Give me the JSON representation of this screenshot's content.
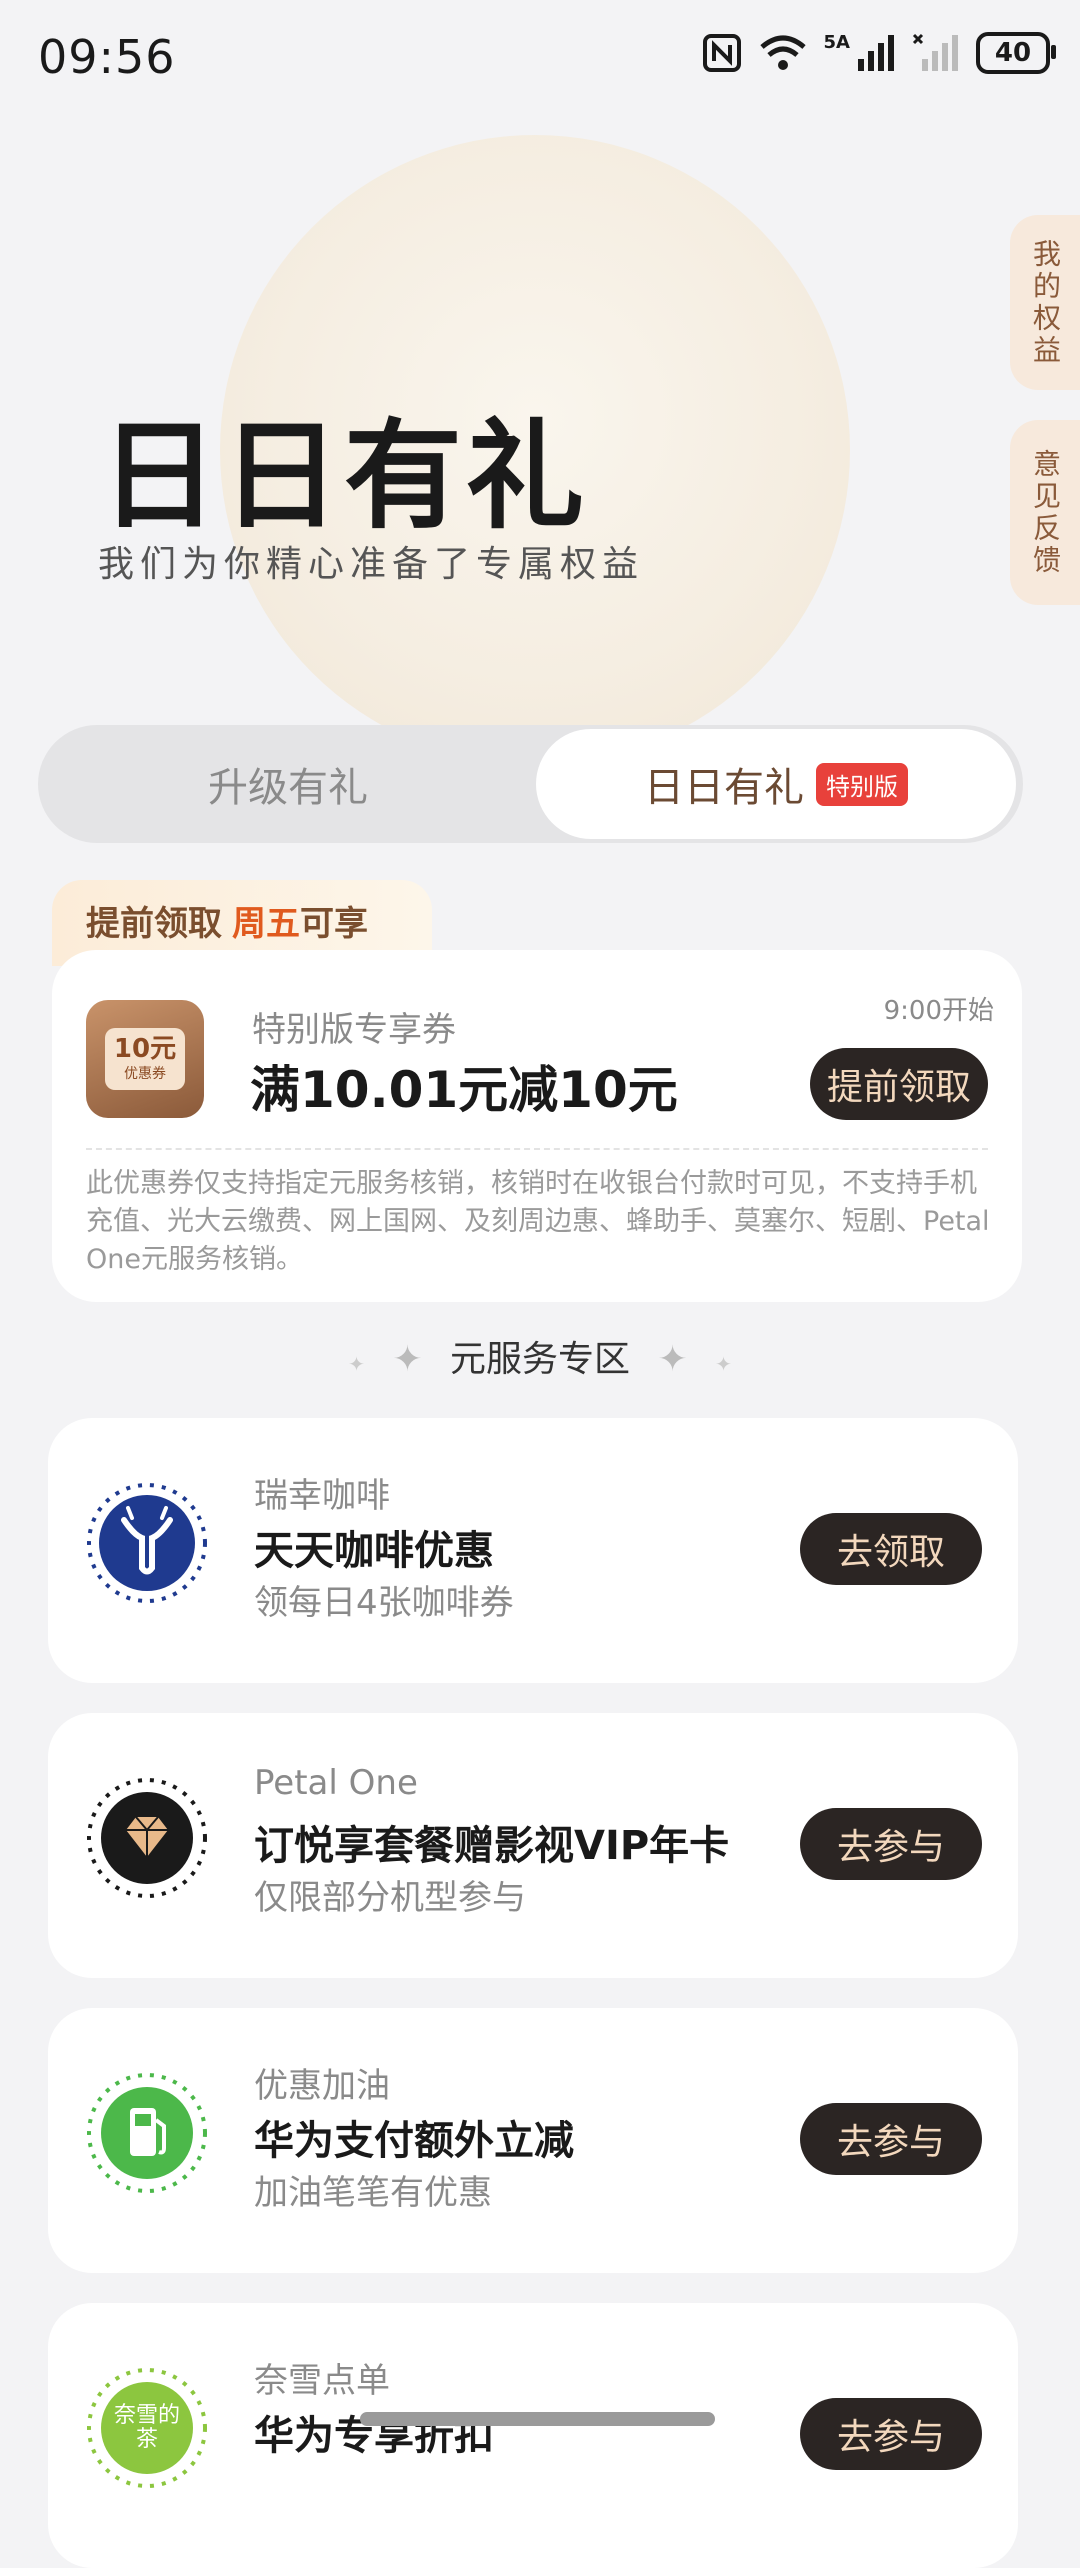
{
  "status_bar": {
    "time": "09:56",
    "network": "5A",
    "battery": "40"
  },
  "hero": {
    "title": "日日有礼",
    "subtitle": "我们为你精心准备了专属权益"
  },
  "side_tabs": {
    "my_benefits": "我的权益",
    "feedback": "意见反馈"
  },
  "tabs": {
    "upgrade": "升级有礼",
    "daily": "日日有礼",
    "daily_badge": "特别版"
  },
  "early_tag": {
    "prefix": "提前领取",
    "day": "周五",
    "suffix": "可享"
  },
  "coupon": {
    "icon_value": "10元",
    "icon_caption": "优惠券",
    "subtitle": "特别版专享券",
    "title": "满10.01元减10元",
    "start_time": "9:00开始",
    "button": "提前领取",
    "description": "此优惠券仅支持指定元服务核销，核销时在收银台付款时可见，不支持手机充值、光大云缴费、网上国网、及刻周边惠、蜂助手、莫塞尔、短剧、Petal One元服务核销。"
  },
  "section": {
    "title": "元服务专区"
  },
  "services": [
    {
      "brand": "瑞幸咖啡",
      "title": "天天咖啡优惠",
      "desc": "领每日4张咖啡券",
      "button": "去领取",
      "icon": "luckin-deer-icon"
    },
    {
      "brand": "Petal One",
      "title": "订悦享套餐赠影视VIP年卡",
      "desc": "仅限部分机型参与",
      "button": "去参与",
      "icon": "diamond-icon"
    },
    {
      "brand": "优惠加油",
      "title": "华为支付额外立减",
      "desc": "加油笔笔有优惠",
      "button": "去参与",
      "icon": "fuel-pump-icon"
    },
    {
      "brand": "奈雪点单",
      "title": "华为专享折扣",
      "desc": "",
      "button": "去参与",
      "icon": "nayuki-icon",
      "icon_text": "奈雪的茶"
    }
  ],
  "colors": {
    "accent_dark": "#2b2523",
    "accent_text": "#f3d8bd",
    "highlight": "#e05a1e",
    "badge": "#e8413b"
  }
}
